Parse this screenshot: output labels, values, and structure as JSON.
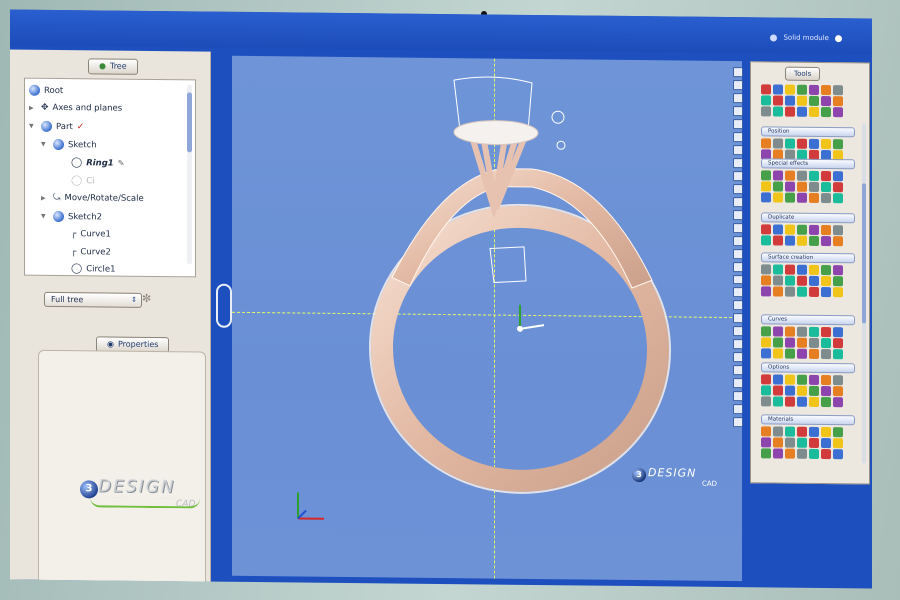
{
  "topbar": {
    "right_label": "Solid module"
  },
  "tree_panel": {
    "tab_label": "Tree",
    "items": [
      {
        "label": "Root"
      },
      {
        "label": "Axes and planes"
      },
      {
        "label": "Part"
      },
      {
        "label": "Sketch"
      },
      {
        "label": "Ring1"
      },
      {
        "label": "Ci"
      },
      {
        "label": "Move/Rotate/Scale"
      },
      {
        "label": "Sketch2"
      },
      {
        "label": "Curve1"
      },
      {
        "label": "Curve2"
      },
      {
        "label": "Circle1"
      }
    ],
    "filter_value": "Full tree"
  },
  "properties_panel": {
    "tab_label": "Properties"
  },
  "logo": {
    "word": "DESIGN",
    "sub": "CAD",
    "ball_text": "3"
  },
  "viewport_watermark": {
    "word": "DESIGN",
    "sub": "CAD",
    "ball_text": "3"
  },
  "tools_panel": {
    "tab_label": "Tools",
    "sections": [
      "Position",
      "Special effects",
      "Duplicate",
      "Surface creation",
      "Curves",
      "Options",
      "Materials"
    ]
  },
  "colors": {
    "viewport_bg": "#6f95d8",
    "ring_color": "#e8c9b9",
    "axis_color": "#e7ff6a",
    "screen_frame": "#1d4fbf"
  }
}
